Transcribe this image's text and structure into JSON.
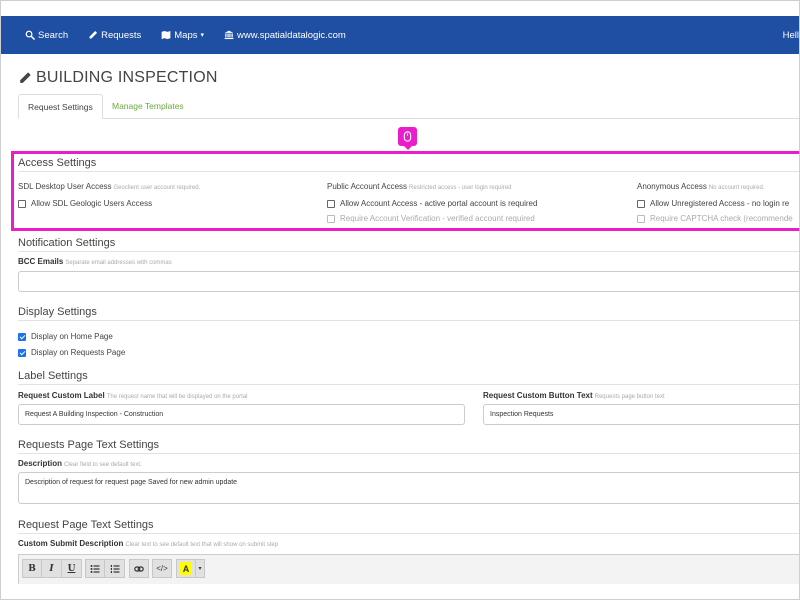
{
  "nav": {
    "search": "Search",
    "requests": "Requests",
    "maps": "Maps",
    "maps_caret": "▾",
    "website": "www.spatialdatalogic.com",
    "greeting": "Hell"
  },
  "page": {
    "title": "BUILDING INSPECTION"
  },
  "tabs": {
    "request_settings": "Request Settings",
    "manage_templates": "Manage Templates"
  },
  "access": {
    "title": "Access Settings",
    "sdl": {
      "title": "SDL Desktop User Access",
      "hint": "Geoclient user account required.",
      "option": "Allow SDL Geologic Users Access"
    },
    "public": {
      "title": "Public Account Access",
      "hint": "Restricted access - user login required",
      "option": "Allow Account Access - active portal account is required",
      "option2": "Require Account Verification - verified account required"
    },
    "anonymous": {
      "title": "Anonymous Access",
      "hint": "No account required.",
      "option": "Allow Unregistered Access - no login re",
      "option2": "Require CAPTCHA check (recommende"
    }
  },
  "notification": {
    "title": "Notification Settings",
    "bcc_label": "BCC Emails",
    "bcc_hint": "Separate email addresses with commas",
    "bcc_value": ""
  },
  "display": {
    "title": "Display Settings",
    "home_page": "Display on Home Page",
    "requests_page": "Display on Requests Page"
  },
  "labels": {
    "title": "Label Settings",
    "custom_label": "Request Custom Label",
    "custom_label_hint": "The request name that will be displayed on the portal",
    "custom_label_value": "Request  A Building Inspection - Construction",
    "button_text_label": "Request Custom Button Text",
    "button_text_hint": "Requests page button text",
    "button_text_value": "Inspection Requests"
  },
  "requests_page_text": {
    "title": "Requests Page Text Settings",
    "description_label": "Description",
    "description_hint": "Clear field to see default text.",
    "description_value": "Description of request for request page Saved for new admin update"
  },
  "request_page_text": {
    "title": "Request Page Text Settings",
    "submit_label": "Custom Submit Description",
    "submit_hint": "Clear text to see default text that will show on submit step"
  },
  "toolbar": {
    "bold": "B",
    "italic": "I",
    "underline": "U",
    "code": "</>",
    "highlight": "A",
    "dropdown": "▾"
  },
  "colors": {
    "navbar": "#1e4fa3",
    "highlight": "#e91ec8",
    "link": "#6aaa3a"
  }
}
